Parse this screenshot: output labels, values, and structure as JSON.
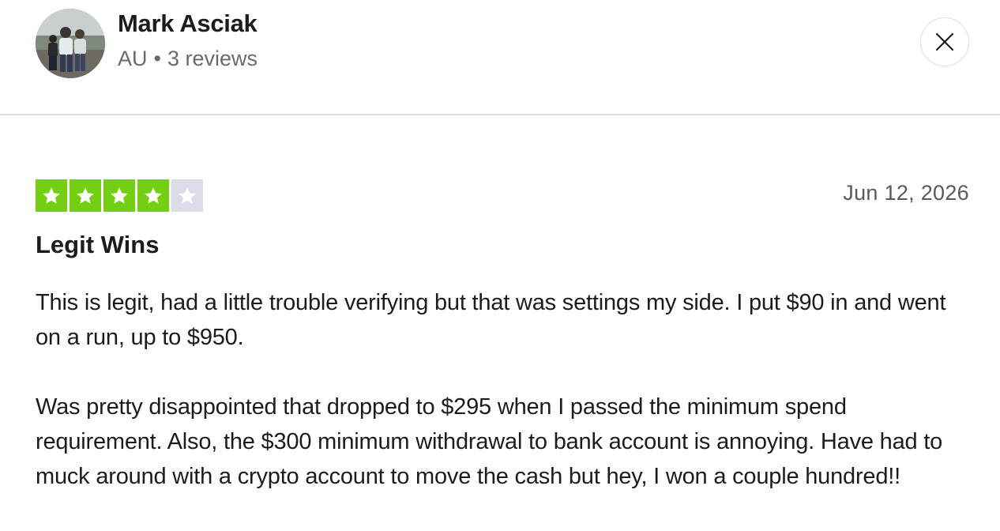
{
  "reviewer": {
    "name": "Mark Asciak",
    "country": "AU",
    "separator": "•",
    "reviews_count": "3 reviews",
    "avatar_icon": "user-photo-avatar"
  },
  "close": {
    "icon": "close-icon"
  },
  "review": {
    "rating": 4,
    "max_rating": 5,
    "star_filled_color": "#73cf11",
    "star_empty_color": "#dcdce6",
    "date": "Jun 12, 2026",
    "title": "Legit Wins",
    "paragraphs": [
      "This is legit, had a little trouble verifying but that was settings my side. I put $90 in and went on a run, up to $950.",
      "Was pretty disappointed that dropped to $295 when I passed the minimum spend requirement. Also, the $300 minimum withdrawal to bank account is annoying. Have had to muck around with a crypto account to move the cash but hey, I won a couple hundred!!"
    ]
  }
}
